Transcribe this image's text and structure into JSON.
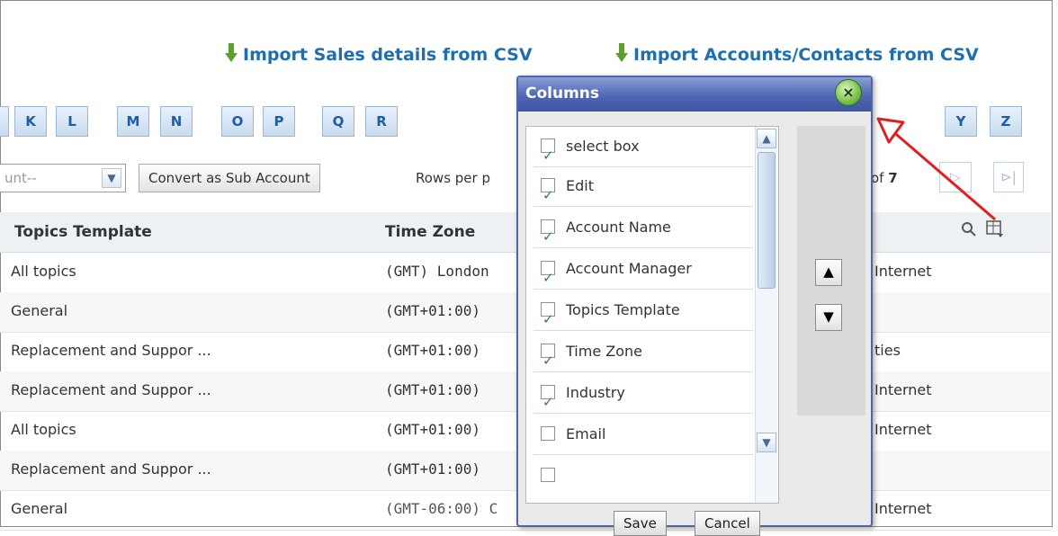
{
  "imports": {
    "sales_label": "Import Sales details from CSV",
    "accounts_label": "Import Accounts/Contacts from CSV"
  },
  "alphabet": {
    "letters": [
      "K",
      "L",
      "M",
      "N",
      "O",
      "P",
      "Q",
      "R",
      "Y",
      "Z"
    ]
  },
  "toolbar": {
    "select_value": "unt--",
    "convert_label": "Convert as Sub Account",
    "rows_per_label": "Rows per p",
    "page_of": "of",
    "page_total": "7"
  },
  "table": {
    "headers": {
      "topics_template": "Topics Template",
      "time_zone": "Time Zone"
    },
    "rows": [
      {
        "topics": "All topics",
        "tz": "(GMT) London",
        "extra": "Internet"
      },
      {
        "topics": "General",
        "tz": "(GMT+01:00)",
        "extra": ""
      },
      {
        "topics": "Replacement and Suppor ...",
        "tz": "(GMT+01:00)",
        "extra": "ties"
      },
      {
        "topics": "Replacement and Suppor ...",
        "tz": "(GMT+01:00)",
        "extra": "Internet"
      },
      {
        "topics": "All topics",
        "tz": "(GMT+01:00)",
        "extra": "Internet"
      },
      {
        "topics": "Replacement and Suppor ...",
        "tz": "(GMT+01:00)",
        "extra": ""
      },
      {
        "topics": "General",
        "tz": "(GMT-06:00) C",
        "extra": "Internet"
      }
    ]
  },
  "columns_popup": {
    "title": "Columns",
    "items": [
      {
        "label": "select box",
        "checked": true
      },
      {
        "label": "Edit",
        "checked": true
      },
      {
        "label": "Account Name",
        "checked": true
      },
      {
        "label": "Account Manager",
        "checked": true
      },
      {
        "label": "Topics Template",
        "checked": true
      },
      {
        "label": "Time Zone",
        "checked": true
      },
      {
        "label": "Industry",
        "checked": true
      },
      {
        "label": "Email",
        "checked": false
      }
    ],
    "save_label": "Save",
    "cancel_label": "Cancel"
  },
  "colors": {
    "link_blue": "#1f6fb0",
    "accent_blue": "#4f66b3",
    "annotation_red": "#e02020"
  }
}
